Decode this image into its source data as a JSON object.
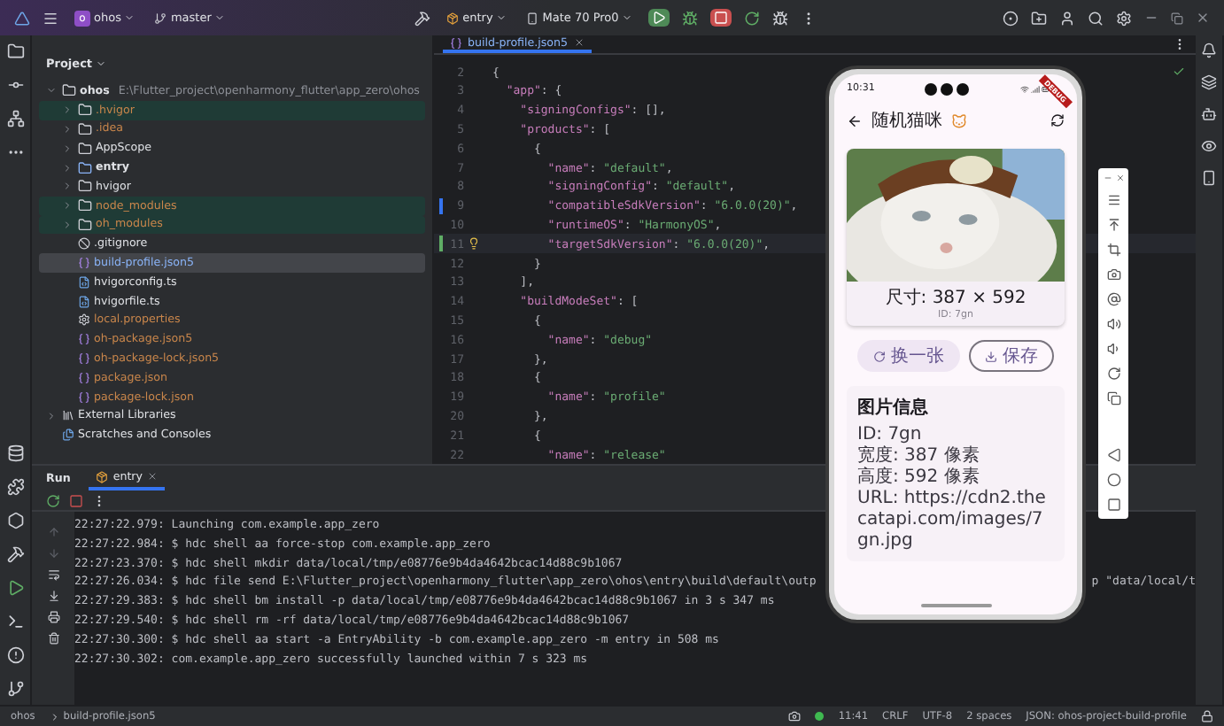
{
  "toolbar": {
    "project": {
      "badge": "o",
      "name": "ohos"
    },
    "branch": "master",
    "run_config": "entry",
    "device": "Mate 70 Pro0"
  },
  "project_panel": {
    "title": "Project",
    "tree": [
      {
        "label": "ohos",
        "path": "E:\\Flutter_project\\openharmony_flutter\\app_zero\\ohos",
        "kind": "root",
        "expanded": true,
        "ignored": false,
        "highlighted": false,
        "selected": false,
        "children": [
          {
            "label": ".hvigor",
            "kind": "folder",
            "expanded": false,
            "ignored": true,
            "highlighted": true,
            "selected": false
          },
          {
            "label": ".idea",
            "kind": "folder",
            "expanded": false,
            "ignored": true,
            "highlighted": false,
            "selected": false
          },
          {
            "label": "AppScope",
            "kind": "folder",
            "expanded": false,
            "ignored": false,
            "highlighted": false,
            "selected": false
          },
          {
            "label": "entry",
            "kind": "module",
            "expanded": false,
            "ignored": false,
            "highlighted": false,
            "selected": false
          },
          {
            "label": "hvigor",
            "kind": "folder",
            "expanded": false,
            "ignored": false,
            "highlighted": false,
            "selected": false
          },
          {
            "label": "node_modules",
            "kind": "folder",
            "expanded": false,
            "ignored": true,
            "highlighted": true,
            "selected": false
          },
          {
            "label": "oh_modules",
            "kind": "folder",
            "expanded": false,
            "ignored": true,
            "highlighted": true,
            "selected": false
          },
          {
            "label": ".gitignore",
            "kind": "gitignore",
            "ignored": false,
            "highlighted": false,
            "selected": false
          },
          {
            "label": "build-profile.json5",
            "kind": "json",
            "ignored": false,
            "highlighted": false,
            "selected": true
          },
          {
            "label": "hvigorconfig.ts",
            "kind": "ts",
            "ignored": false,
            "highlighted": false,
            "selected": false
          },
          {
            "label": "hvigorfile.ts",
            "kind": "ts",
            "ignored": false,
            "highlighted": false,
            "selected": false
          },
          {
            "label": "local.properties",
            "kind": "properties",
            "ignored": true,
            "highlighted": false,
            "selected": false
          },
          {
            "label": "oh-package.json5",
            "kind": "json",
            "ignored": true,
            "highlighted": false,
            "selected": false
          },
          {
            "label": "oh-package-lock.json5",
            "kind": "json",
            "ignored": true,
            "highlighted": false,
            "selected": false
          },
          {
            "label": "package.json",
            "kind": "json",
            "ignored": true,
            "highlighted": false,
            "selected": false
          },
          {
            "label": "package-lock.json",
            "kind": "json",
            "ignored": true,
            "highlighted": false,
            "selected": false
          }
        ]
      },
      {
        "label": "External Libraries",
        "kind": "library",
        "expanded": false,
        "ignored": false,
        "highlighted": false,
        "selected": false
      },
      {
        "label": "Scratches and Consoles",
        "kind": "scratches",
        "ignored": false,
        "highlighted": false,
        "selected": false
      }
    ]
  },
  "editor": {
    "tabs": [
      {
        "label": "build-profile.json5",
        "selected": true
      }
    ],
    "lines": [
      {
        "number": "2",
        "current": false,
        "tokens": [
          {
            "kind": "punct",
            "text": "{"
          }
        ]
      },
      {
        "number": "3",
        "current": false,
        "tokens": [
          {
            "kind": "key",
            "text": "  \"app\""
          },
          {
            "kind": "punct",
            "text": ": {"
          }
        ]
      },
      {
        "number": "4",
        "current": false,
        "tokens": [
          {
            "kind": "key",
            "text": "    \"signingConfigs\""
          },
          {
            "kind": "punct",
            "text": ": [],"
          }
        ]
      },
      {
        "number": "5",
        "current": false,
        "tokens": [
          {
            "kind": "key",
            "text": "    \"products\""
          },
          {
            "kind": "punct",
            "text": ": ["
          }
        ]
      },
      {
        "number": "6",
        "current": false,
        "tokens": [
          {
            "kind": "punct",
            "text": "      {"
          }
        ]
      },
      {
        "number": "7",
        "current": false,
        "tokens": [
          {
            "kind": "key",
            "text": "        \"name\""
          },
          {
            "kind": "punct",
            "text": ": "
          },
          {
            "kind": "string",
            "text": "\"default\""
          },
          {
            "kind": "punct",
            "text": ","
          }
        ]
      },
      {
        "number": "8",
        "current": false,
        "tokens": [
          {
            "kind": "key",
            "text": "        \"signingConfig\""
          },
          {
            "kind": "punct",
            "text": ": "
          },
          {
            "kind": "string",
            "text": "\"default\""
          },
          {
            "kind": "punct",
            "text": ","
          }
        ]
      },
      {
        "number": "9",
        "current": false,
        "color": "#3574f0",
        "tokens": [
          {
            "kind": "key",
            "text": "        \"compatibleSdkVersion\""
          },
          {
            "kind": "punct",
            "text": ": "
          },
          {
            "kind": "string",
            "text": "\"6.0.0(20)\""
          },
          {
            "kind": "punct",
            "text": ","
          }
        ]
      },
      {
        "number": "10",
        "current": false,
        "tokens": [
          {
            "kind": "key",
            "text": "        \"runtimeOS\""
          },
          {
            "kind": "punct",
            "text": ": "
          },
          {
            "kind": "string",
            "text": "\"HarmonyOS\""
          },
          {
            "kind": "punct",
            "text": ","
          }
        ]
      },
      {
        "number": "11",
        "current": true,
        "color": "#5fad65",
        "bulb": true,
        "tokens": [
          {
            "kind": "key",
            "text": "        \"targetSdkVersion\""
          },
          {
            "kind": "punct",
            "text": ": "
          },
          {
            "kind": "string",
            "text": "\"6.0.0(20)\""
          },
          {
            "kind": "punct",
            "text": ","
          }
        ]
      },
      {
        "number": "12",
        "current": false,
        "tokens": [
          {
            "kind": "punct",
            "text": "      }"
          }
        ]
      },
      {
        "number": "13",
        "current": false,
        "tokens": [
          {
            "kind": "punct",
            "text": "    ],"
          }
        ]
      },
      {
        "number": "14",
        "current": false,
        "tokens": [
          {
            "kind": "key",
            "text": "    \"buildModeSet\""
          },
          {
            "kind": "punct",
            "text": ": ["
          }
        ]
      },
      {
        "number": "15",
        "current": false,
        "tokens": [
          {
            "kind": "punct",
            "text": "      {"
          }
        ]
      },
      {
        "number": "16",
        "current": false,
        "tokens": [
          {
            "kind": "key",
            "text": "        \"name\""
          },
          {
            "kind": "punct",
            "text": ": "
          },
          {
            "kind": "string",
            "text": "\"debug\""
          }
        ]
      },
      {
        "number": "17",
        "current": false,
        "tokens": [
          {
            "kind": "punct",
            "text": "      },"
          }
        ]
      },
      {
        "number": "18",
        "current": false,
        "tokens": [
          {
            "kind": "punct",
            "text": "      {"
          }
        ]
      },
      {
        "number": "19",
        "current": false,
        "tokens": [
          {
            "kind": "key",
            "text": "        \"name\""
          },
          {
            "kind": "punct",
            "text": ": "
          },
          {
            "kind": "string",
            "text": "\"profile\""
          }
        ]
      },
      {
        "number": "20",
        "current": false,
        "tokens": [
          {
            "kind": "punct",
            "text": "      },"
          }
        ]
      },
      {
        "number": "21",
        "current": false,
        "tokens": [
          {
            "kind": "punct",
            "text": "      {"
          }
        ]
      },
      {
        "number": "22",
        "current": false,
        "tokens": [
          {
            "kind": "key",
            "text": "        \"name\""
          },
          {
            "kind": "punct",
            "text": ": "
          },
          {
            "kind": "string",
            "text": "\"release\""
          }
        ]
      }
    ]
  },
  "run_panel": {
    "title": "Run",
    "tabs": [
      {
        "label": "entry",
        "selected": true
      }
    ],
    "lines": [
      {
        "text": "22:27:22.979: Launching com.example.app_zero"
      },
      {
        "text": "22:27:22.984: $ hdc shell aa force-stop com.example.app_zero"
      },
      {
        "text": "22:27:23.370: $ hdc shell mkdir data/local/tmp/e08776e9b4da4642bcac14d88c9b1067"
      },
      {
        "text": "22:27:26.034: $ hdc file send E:\\Flutter_project\\openharmony_flutter\\app_zero\\ohos\\entry\\build\\default\\outp",
        "tail": "p \"data/local/t"
      },
      {
        "text": "22:27:29.383: $ hdc shell bm install -p data/local/tmp/e08776e9b4da4642bcac14d88c9b1067 in 3 s 347 ms"
      },
      {
        "text": "22:27:29.540: $ hdc shell rm -rf data/local/tmp/e08776e9b4da4642bcac14d88c9b1067"
      },
      {
        "text": "22:27:30.300: $ hdc shell aa start -a EntryAbility -b com.example.app_zero -m entry in 508 ms"
      },
      {
        "text": "22:27:30.302: com.example.app_zero successfully launched within 7 s 323 ms"
      }
    ]
  },
  "phone": {
    "time": "10:31",
    "debug_banner": "DEBUG",
    "title": "随机猫咪",
    "size_caption": "尺寸: 387 × 592",
    "id_caption": "ID: 7gn",
    "buttons": [
      {
        "label": "换一张",
        "kind": "refresh"
      },
      {
        "label": "保存",
        "kind": "download"
      }
    ],
    "info": {
      "title": "图片信息",
      "lines": [
        "ID: 7gn",
        "宽度: 387 像素",
        "高度: 592 像素",
        "URL: https://cdn2.thecatapi.com/images/7gn.jpg"
      ]
    }
  },
  "status_bar": {
    "breadcrumb": [
      "ohos",
      "build-profile.json5"
    ],
    "items": [
      "11:41",
      "CRLF",
      "UTF-8",
      "2 spaces",
      "JSON: ohos-project-build-profile"
    ]
  }
}
